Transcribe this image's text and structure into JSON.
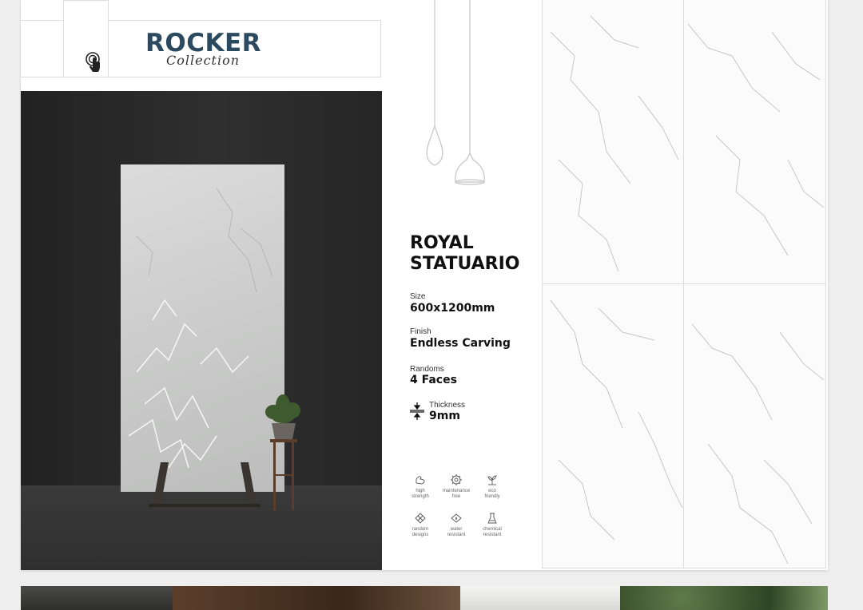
{
  "brand": {
    "logo_main": "ROCKER",
    "logo_sub": "Collection"
  },
  "product": {
    "name_line1": "ROYAL",
    "name_line2": "STATUARIO"
  },
  "specs": {
    "size_label": "Size",
    "size_value": "600x1200mm",
    "finish_label": "Finish",
    "finish_value": "Endless Carving",
    "randoms_label": "Randoms",
    "randoms_value": "4 Faces",
    "thickness_label": "Thickness",
    "thickness_value": "9mm"
  },
  "features": [
    {
      "line1": "high",
      "line2": "strength",
      "icon": "high-strength-icon"
    },
    {
      "line1": "maintenance",
      "line2": "free",
      "icon": "maintenance-free-icon"
    },
    {
      "line1": "eco",
      "line2": "friendly",
      "icon": "eco-friendly-icon"
    },
    {
      "line1": "random",
      "line2": "designs",
      "icon": "random-designs-icon"
    },
    {
      "line1": "water",
      "line2": "resistant",
      "icon": "water-resistant-icon"
    },
    {
      "line1": "chemical",
      "line2": "resistant",
      "icon": "chemical-resistant-icon"
    }
  ],
  "colors": {
    "brand_blue": "#2b4a5f",
    "background": "#eeeeee",
    "page": "#ffffff",
    "text": "#111111"
  }
}
